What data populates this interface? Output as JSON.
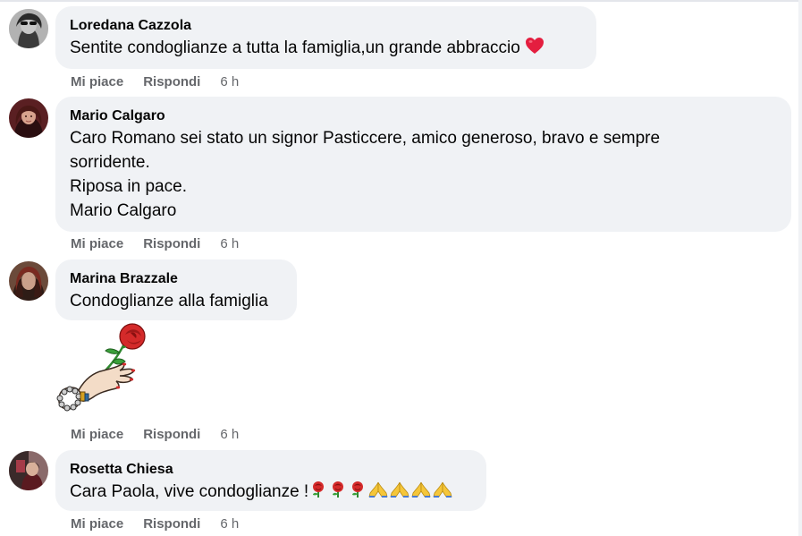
{
  "comments": [
    {
      "author": "Loredana Cazzola",
      "lines": [
        "Sentite condoglianze a tutta la famiglia,un grande abbraccio"
      ],
      "like": "Mi piace",
      "reply": "Rispondi",
      "time": "6 h"
    },
    {
      "author": "Mario Calgaro",
      "lines": [
        "Caro Romano sei stato un signor Pasticcere, amico generoso, bravo e sempre",
        "sorridente.",
        "Riposa in pace.",
        "Mario Calgaro"
      ],
      "like": "Mi piace",
      "reply": "Rispondi",
      "time": "6 h"
    },
    {
      "author": "Marina Brazzale",
      "lines": [
        "Condoglianze alla famiglia"
      ],
      "like": "Mi piace",
      "reply": "Rispondi",
      "time": "6 h"
    },
    {
      "author": "Rosetta Chiesa",
      "lines": [
        "Cara Paola, vive condoglianze !"
      ],
      "like": "Mi piace",
      "reply": "Rispondi",
      "time": "6 h"
    }
  ],
  "icons": {
    "heart": "heart-emoji-icon",
    "rose": "rose-emoji-icon",
    "pray": "folded-hands-emoji-icon",
    "sticker": "hand-holding-rose-sticker"
  },
  "colors": {
    "bubble": "#f0f2f5",
    "secondary_text": "#65676b",
    "primary_text": "#050505",
    "heart": "#e41e3f"
  }
}
